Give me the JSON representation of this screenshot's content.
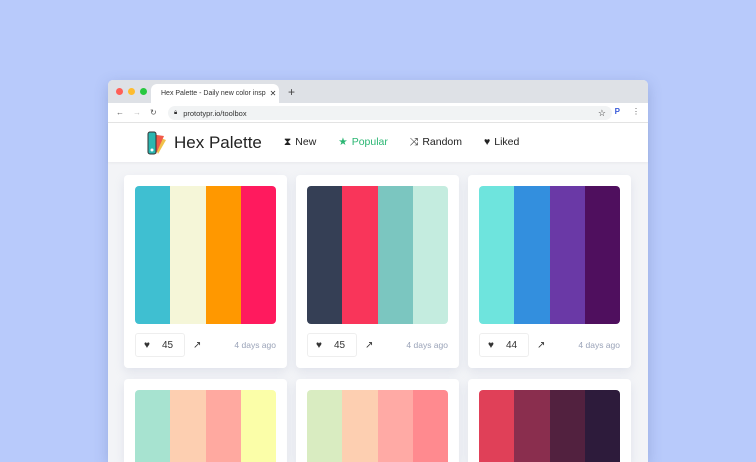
{
  "browser": {
    "tab_title": "Hex Palette - Daily new color insp",
    "url": "prototypr.io/toolbox"
  },
  "header": {
    "logo": "Hex Palette",
    "nav": [
      {
        "label": "New",
        "icon": "hourglass-icon"
      },
      {
        "label": "Popular",
        "icon": "star-icon"
      },
      {
        "label": "Random",
        "icon": "shuffle-icon"
      },
      {
        "label": "Liked",
        "icon": "heart-icon"
      }
    ],
    "active_color": "#2bb673"
  },
  "palettes": [
    {
      "colors": [
        "#3fbfd1",
        "#f5f6d8",
        "#ff9800",
        "#ff1a5e"
      ],
      "likes": "45",
      "time": "4 days ago"
    },
    {
      "colors": [
        "#353f55",
        "#f9355a",
        "#7bc6c0",
        "#c4ecdf"
      ],
      "likes": "45",
      "time": "4 days ago"
    },
    {
      "colors": [
        "#6ee4dd",
        "#338fde",
        "#6a39a6",
        "#4f0f5e"
      ],
      "likes": "44",
      "time": "4 days ago"
    },
    {
      "colors": [
        "#a7e3d0",
        "#fdcfb1",
        "#ffa9a0",
        "#fbfea8"
      ]
    },
    {
      "colors": [
        "#d9ecc1",
        "#fdcfb1",
        "#ffaaa5",
        "#ff8a8f"
      ]
    },
    {
      "colors": [
        "#e04058",
        "#8a2e4e",
        "#52213f",
        "#2d1b3b"
      ]
    }
  ]
}
